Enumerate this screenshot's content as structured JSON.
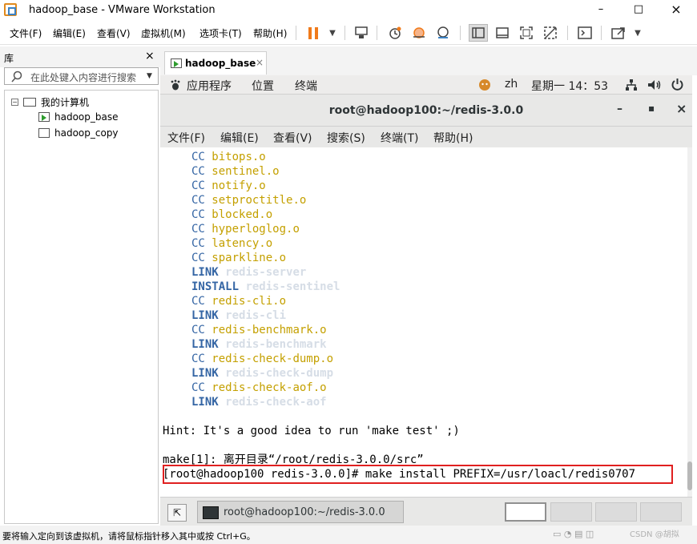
{
  "window": {
    "title": "hadoop_base - VMware Workstation",
    "minimize": "–",
    "maximize": "□",
    "close": "×"
  },
  "menubar": {
    "items": [
      "文件(F)",
      "编辑(E)",
      "查看(V)",
      "虚拟机(M)",
      "选项卡(T)",
      "帮助(H)"
    ]
  },
  "library": {
    "title": "库",
    "close": "×",
    "search_placeholder": "在此处键入内容进行搜索",
    "tree": {
      "root_label": "我的计算机",
      "root_expander": "−",
      "items": [
        "hadoop_base",
        "hadoop_copy"
      ]
    }
  },
  "vm_tab": {
    "label": "hadoop_base",
    "close": "×"
  },
  "gnome_panel": {
    "applications": "应用程序",
    "places": "位置",
    "terminal": "终端",
    "input_method": "zh",
    "clock": "星期一 14：53"
  },
  "terminal": {
    "title": "root@hadoop100:~/redis-3.0.0",
    "minimize": "–",
    "maximize": "▪",
    "close": "×",
    "menu": [
      "文件(F)",
      "编辑(E)",
      "查看(V)",
      "搜索(S)",
      "终端(T)",
      "帮助(H)"
    ],
    "build_lines": [
      {
        "kind": "CC",
        "name": "bitops.o"
      },
      {
        "kind": "CC",
        "name": "sentinel.o"
      },
      {
        "kind": "CC",
        "name": "notify.o"
      },
      {
        "kind": "CC",
        "name": "setproctitle.o"
      },
      {
        "kind": "CC",
        "name": "blocked.o"
      },
      {
        "kind": "CC",
        "name": "hyperloglog.o"
      },
      {
        "kind": "CC",
        "name": "latency.o"
      },
      {
        "kind": "CC",
        "name": "sparkline.o"
      },
      {
        "kind": "LINK",
        "name": "redis-server"
      },
      {
        "kind": "INSTALL",
        "name": "redis-sentinel"
      },
      {
        "kind": "CC",
        "name": "redis-cli.o"
      },
      {
        "kind": "LINK",
        "name": "redis-cli"
      },
      {
        "kind": "CC",
        "name": "redis-benchmark.o"
      },
      {
        "kind": "LINK",
        "name": "redis-benchmark"
      },
      {
        "kind": "CC",
        "name": "redis-check-dump.o"
      },
      {
        "kind": "LINK",
        "name": "redis-check-dump"
      },
      {
        "kind": "CC",
        "name": "redis-check-aof.o"
      },
      {
        "kind": "LINK",
        "name": "redis-check-aof"
      }
    ],
    "hint": "Hint: It's a good idea to run 'make test' ;)",
    "make_leave": "make[1]: 离开目录“/root/redis-3.0.0/src”",
    "prompt": "[root@hadoop100 redis-3.0.0]",
    "command": "# make install PREFIX=/usr/loacl/redis0707"
  },
  "bottom_panel": {
    "task_label": "root@hadoop100:~/redis-3.0.0",
    "workspaces": 4
  },
  "status": {
    "text": "要将输入定向到该虚拟机，请将鼠标指针移入其中或按 Ctrl+G。",
    "watermark": "CSDN @胡拟"
  },
  "colors": {
    "accent_orange": "#f07a1a",
    "terminal_blue": "#3465a4",
    "terminal_yellow": "#c4a000",
    "highlight_red": "#e02020"
  }
}
